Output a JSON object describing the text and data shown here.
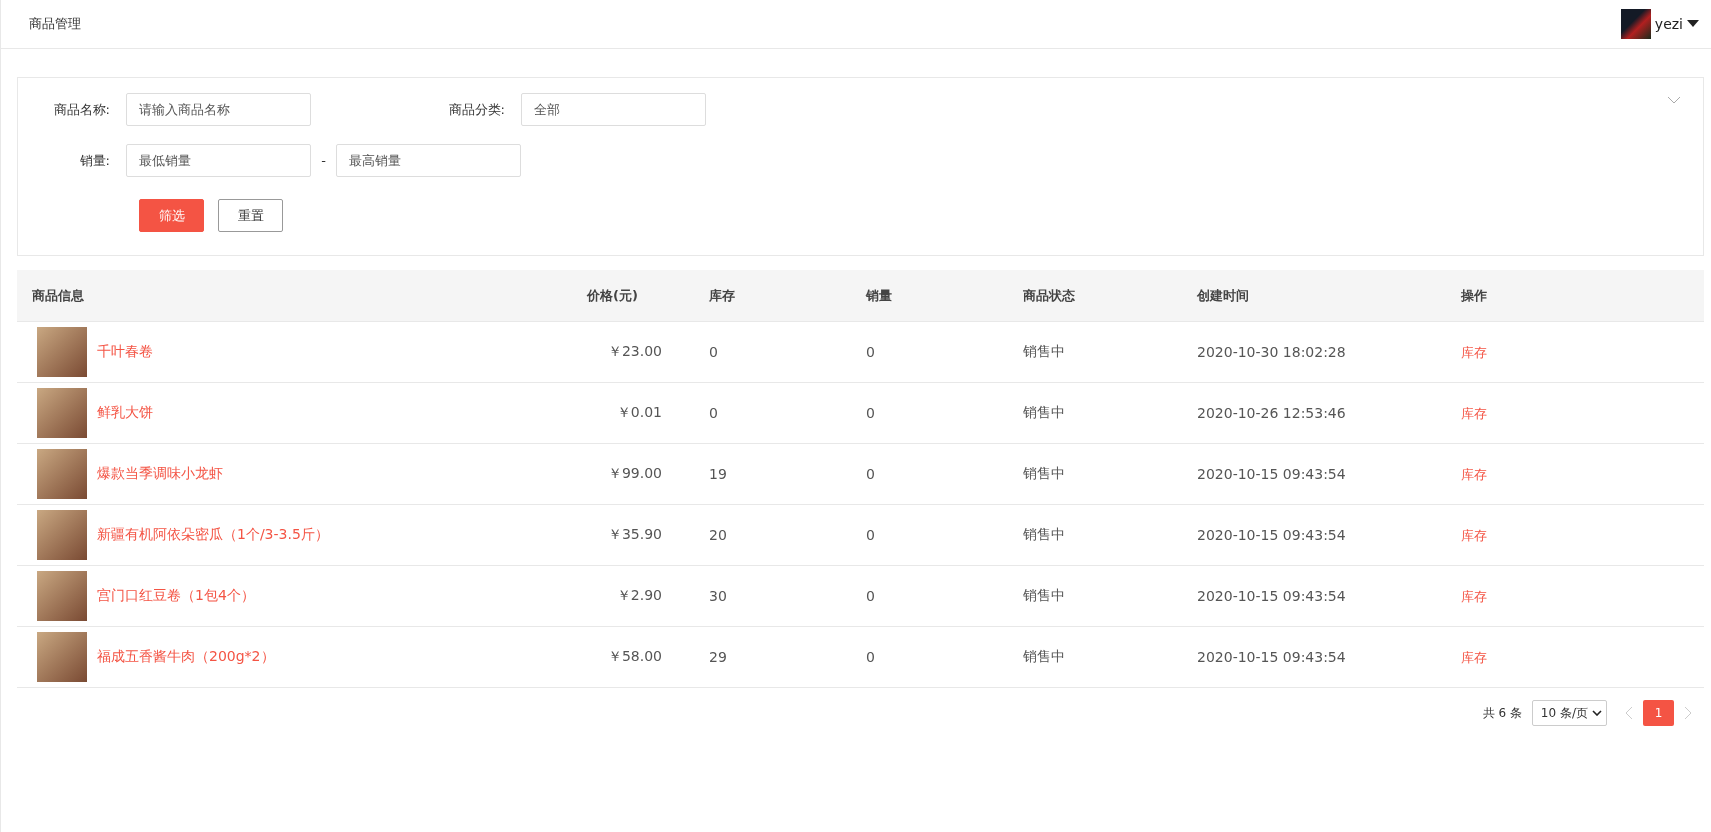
{
  "header": {
    "title": "商品管理",
    "user": {
      "name": "yezi"
    }
  },
  "filters": {
    "name": {
      "label": "商品名称:",
      "placeholder": "请输入商品名称"
    },
    "category": {
      "label": "商品分类:",
      "value": "全部"
    },
    "sales": {
      "label": "销量:",
      "min_placeholder": "最低销量",
      "separator": "-",
      "max_placeholder": "最高销量"
    },
    "buttons": [
      {
        "label": "筛选",
        "kind": "primary"
      },
      {
        "label": "重置",
        "kind": "default"
      }
    ]
  },
  "table": {
    "columns": [
      "商品信息",
      "价格(元)",
      "库存",
      "销量",
      "商品状态",
      "创建时间",
      "操作"
    ],
    "rows": [
      {
        "name": "千叶春卷",
        "price": "￥23.00",
        "stock": "0",
        "sales": "0",
        "status": "销售中",
        "created": "2020-10-30 18:02:28",
        "action": "库存"
      },
      {
        "name": "鲜乳大饼",
        "price": "￥0.01",
        "stock": "0",
        "sales": "0",
        "status": "销售中",
        "created": "2020-10-26 12:53:46",
        "action": "库存"
      },
      {
        "name": "爆款当季调味小龙虾",
        "price": "￥99.00",
        "stock": "19",
        "sales": "0",
        "status": "销售中",
        "created": "2020-10-15 09:43:54",
        "action": "库存"
      },
      {
        "name": "新疆有机阿依朵密瓜（1个/3-3.5斤）",
        "price": "￥35.90",
        "stock": "20",
        "sales": "0",
        "status": "销售中",
        "created": "2020-10-15 09:43:54",
        "action": "库存"
      },
      {
        "name": "宫门口红豆卷（1包4个）",
        "price": "￥2.90",
        "stock": "30",
        "sales": "0",
        "status": "销售中",
        "created": "2020-10-15 09:43:54",
        "action": "库存"
      },
      {
        "name": "福成五香酱牛肉（200g*2）",
        "price": "￥58.00",
        "stock": "29",
        "sales": "0",
        "status": "销售中",
        "created": "2020-10-15 09:43:54",
        "action": "库存"
      }
    ]
  },
  "pagination": {
    "total": "共 6 条",
    "page_size": "10 条/页",
    "pages": [
      {
        "label": "1",
        "selected": true
      }
    ]
  }
}
